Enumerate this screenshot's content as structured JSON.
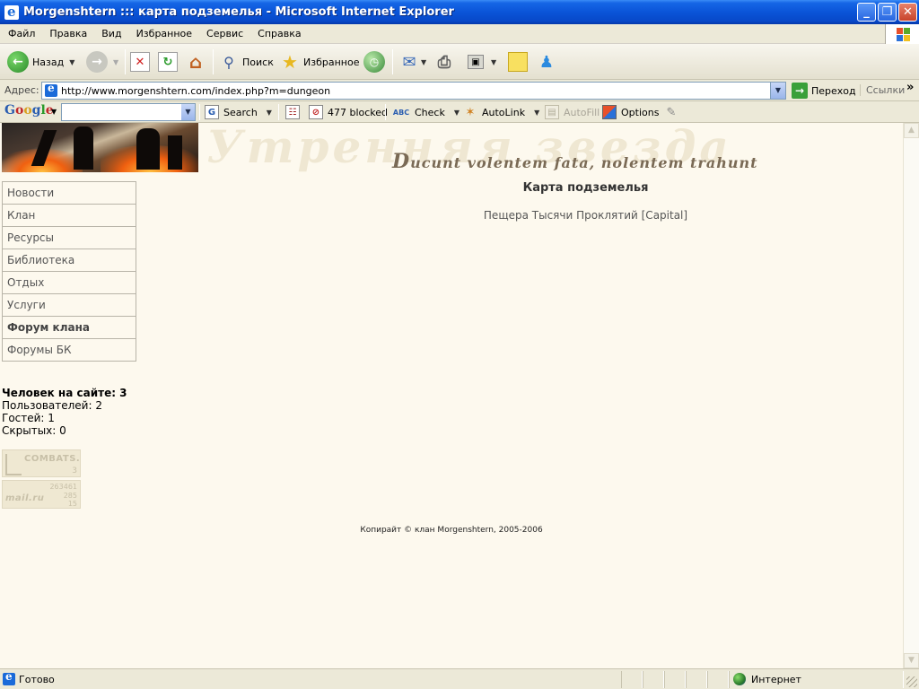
{
  "window": {
    "title": "Morgenshtern ::: карта подземелья - Microsoft Internet Explorer",
    "minimize": "_",
    "maximize": "❐",
    "close": "✕"
  },
  "menu": [
    "Файл",
    "Правка",
    "Вид",
    "Избранное",
    "Сервис",
    "Справка"
  ],
  "toolbar": {
    "back": "Назад",
    "search": "Поиск",
    "favorites": "Избранное"
  },
  "address": {
    "label": "Адрес:",
    "url": "http://www.morgenshtern.com/index.php?m=dungeon",
    "go": "Переход",
    "links": "Ссылки"
  },
  "google_toolbar": {
    "search": "Search",
    "blocked": "477 blocked",
    "check": "Check",
    "autolink": "AutoLink",
    "autofill": "AutoFill",
    "options": "Options"
  },
  "page": {
    "header_bg_text": "Утренняя звезда",
    "motto_cap": "D",
    "motto_rest": "ucunt volentem fata, nolentem trahunt",
    "nav": [
      {
        "label": "Новости",
        "bold": false
      },
      {
        "label": "Клан",
        "bold": false
      },
      {
        "label": "Ресурсы",
        "bold": false
      },
      {
        "label": "Библиотека",
        "bold": false
      },
      {
        "label": "Отдых",
        "bold": false
      },
      {
        "label": "Услуги",
        "bold": false
      },
      {
        "label": "Форум клана",
        "bold": true
      },
      {
        "label": "Форумы БК",
        "bold": false
      }
    ],
    "heading": "Карта подземелья",
    "dungeon_link": "Пещера Тысячи Проклятий [Capital]",
    "stats": {
      "title": "Человек на сайте: 3",
      "users": "Пользователей: 2",
      "guests": "Гостей: 1",
      "hidden": "Скрытых: 0"
    },
    "counters": {
      "combats_name": "COMBATS.RU",
      "combats_value": "3",
      "mail_top": "263461",
      "mail_name": "mail.ru",
      "mail_v1": "285",
      "mail_v2": "15"
    },
    "copyright": "Копирайт © клан Morgenshtern, 2005-2006"
  },
  "status": {
    "text": "Готово",
    "zone": "Интернет"
  }
}
